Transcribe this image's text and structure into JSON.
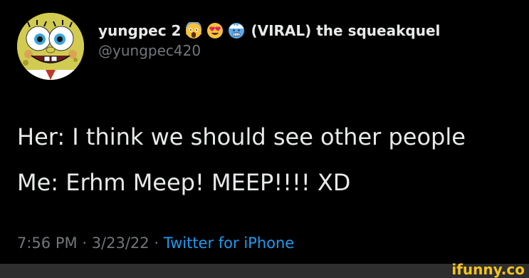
{
  "tweet": {
    "author": {
      "display_name": "yungpec 2",
      "display_name_suffix": "(VIRAL) the squeakquel",
      "handle": "@yungpec420",
      "name_emojis": [
        "scream-emoji",
        "heart-eyes-emoji",
        "cold-face-emoji"
      ],
      "avatar": "spongebob-avatar"
    },
    "lines": [
      "Her: I think we should see other people",
      "Me: Erhm Meep! MEEP!!!! XD"
    ],
    "time": "7:56 PM",
    "separator": "·",
    "date": "3/23/22",
    "source": "Twitter for iPhone"
  },
  "watermark": {
    "text": "ifunny.co"
  },
  "colors": {
    "background": "#000000",
    "text_primary": "#e7e9ea",
    "text_secondary": "#71767b",
    "link": "#1d9bf0",
    "watermark": "#f6c41d",
    "footer_bar": "#2e2e2e"
  }
}
